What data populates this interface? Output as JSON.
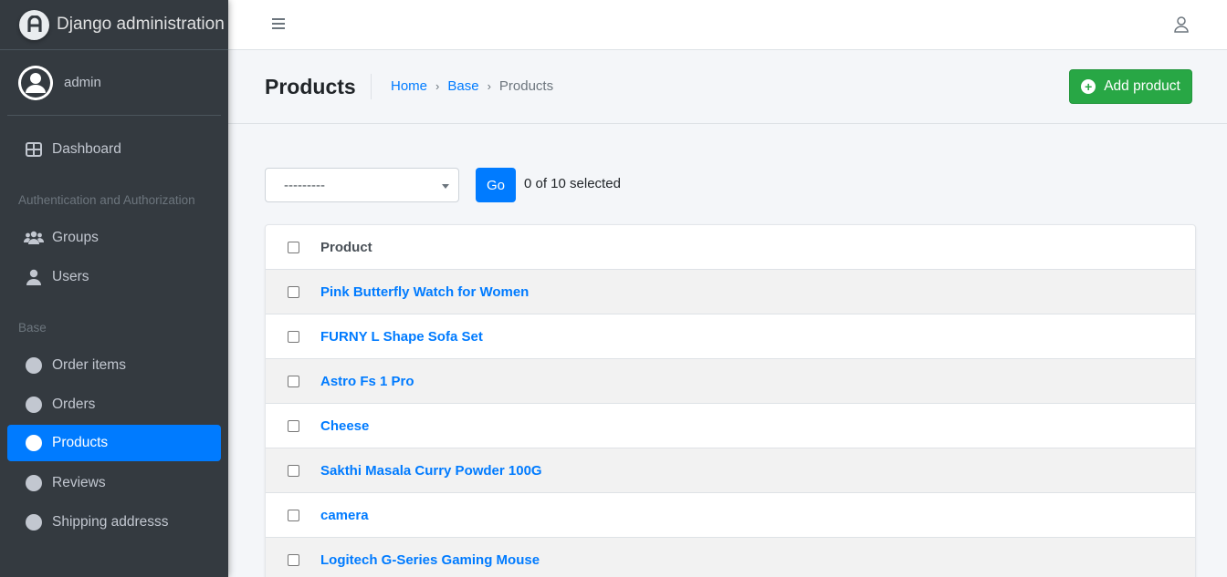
{
  "brand": {
    "title": "Django administration"
  },
  "user": {
    "name": "admin"
  },
  "sidebar": {
    "dashboard": "Dashboard",
    "sections": [
      {
        "header": "Authentication and Authorization",
        "items": [
          "Groups",
          "Users"
        ]
      },
      {
        "header": "Base",
        "items": [
          "Order items",
          "Orders",
          "Products",
          "Reviews",
          "Shipping addresss"
        ]
      }
    ],
    "active_item": "Products"
  },
  "header": {
    "page_title": "Products",
    "breadcrumb": [
      "Home",
      "Base",
      "Products"
    ],
    "add_button": "Add product"
  },
  "actions": {
    "selected_option": "---------",
    "go_label": "Go",
    "selection_status": "0 of 10 selected"
  },
  "table": {
    "column": "Product",
    "rows": [
      "Pink Butterfly Watch for Women",
      "FURNY L Shape Sofa Set",
      "Astro Fs 1 Pro",
      "Cheese",
      "Sakthi Masala Curry Powder 100G",
      "camera",
      "Logitech G-Series Gaming Mouse"
    ]
  },
  "colors": {
    "sidebar_bg": "#343a40",
    "accent": "#007bff",
    "add_button": "#28a745"
  }
}
